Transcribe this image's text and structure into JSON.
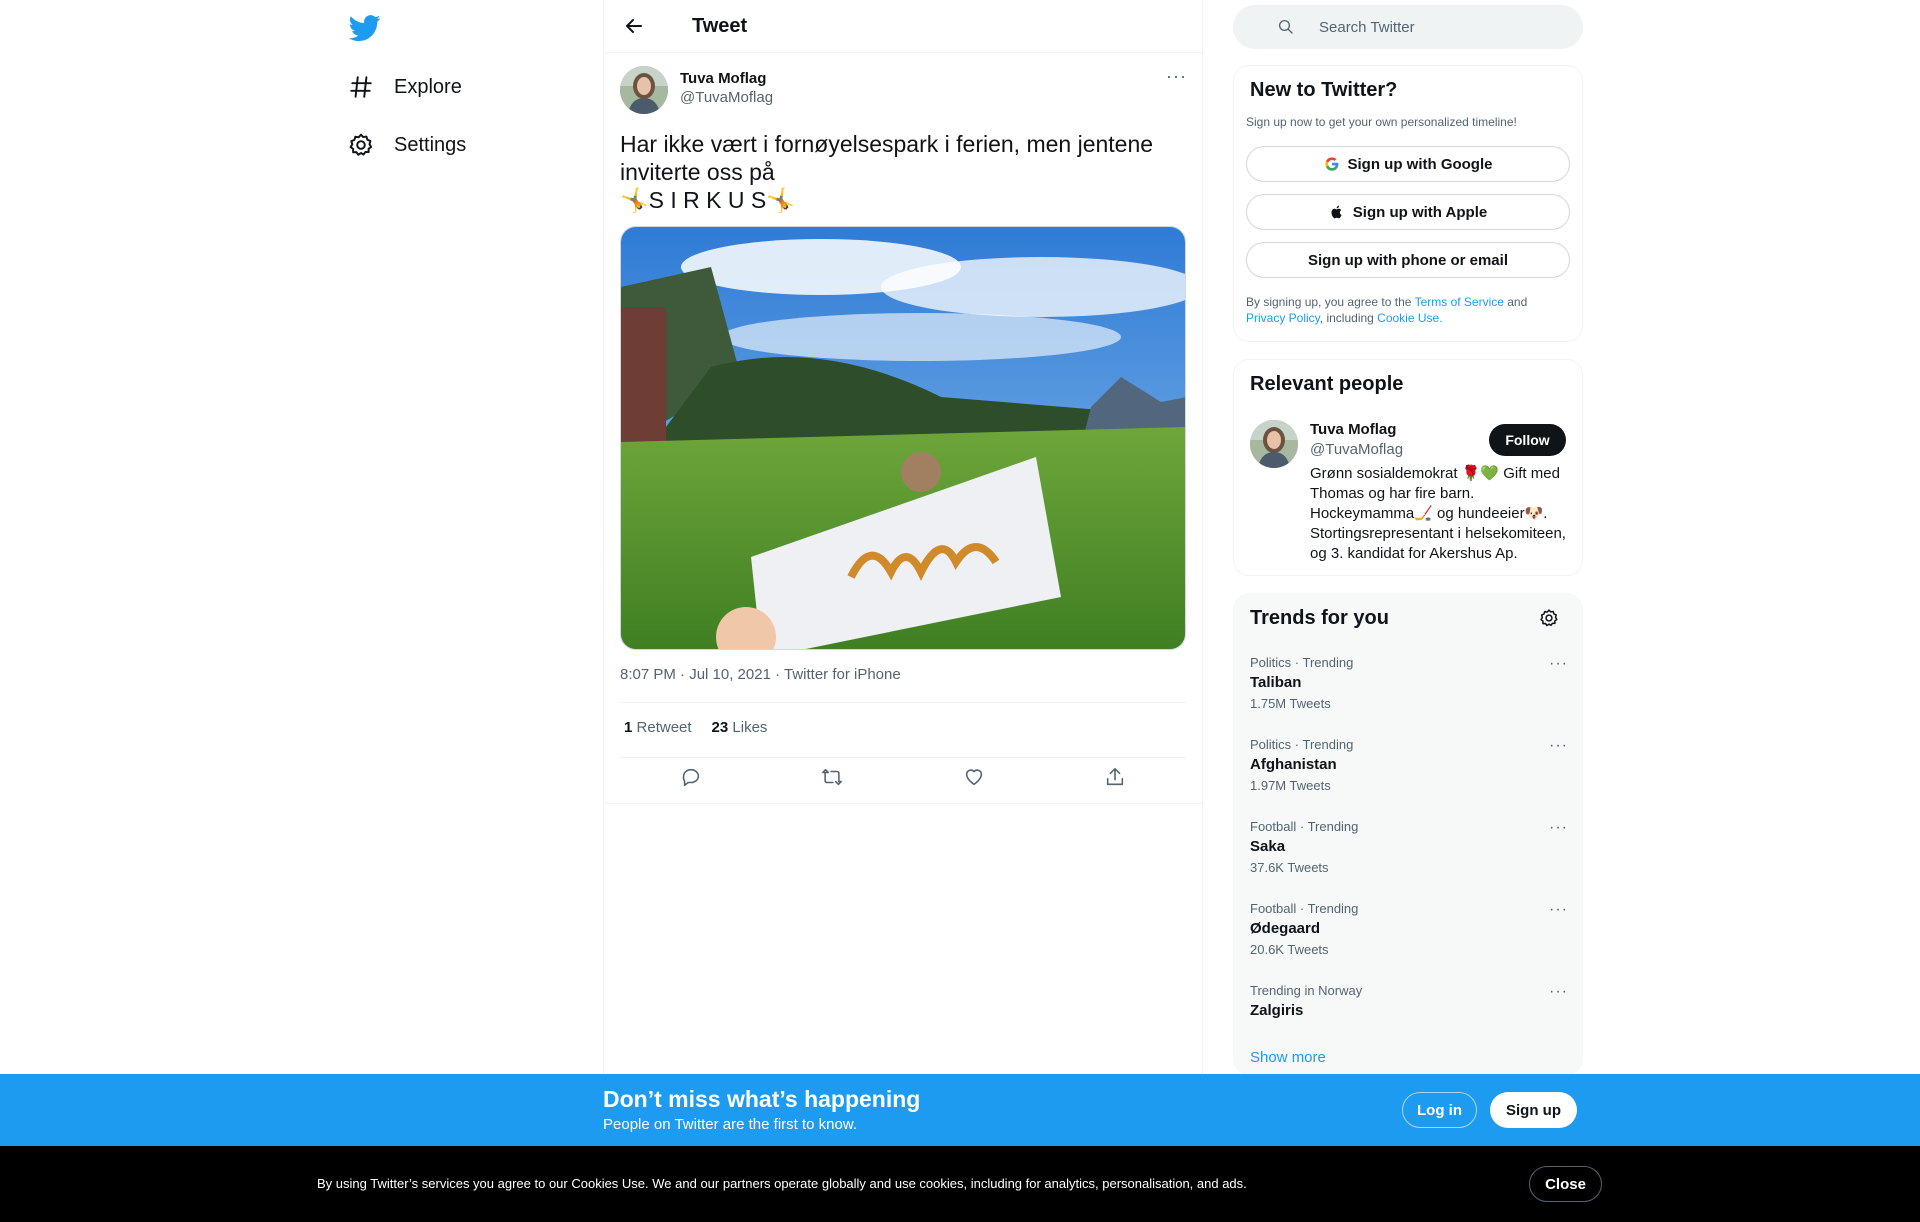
{
  "nav": {
    "logo_icon": "twitter-bird-icon",
    "items": [
      {
        "label": "Explore",
        "icon": "hashtag-icon"
      },
      {
        "label": "Settings",
        "icon": "gear-icon"
      }
    ]
  },
  "header": {
    "title": "Tweet"
  },
  "tweet": {
    "author_name": "Tuva Moflag",
    "author_handle": "@TuvaMoflag",
    "text": "Har ikke vært i fornøyelsespark i ferien, men jentene inviterte oss på\n🤸S I R K U S🤸",
    "image_alt_text": "SIRKUS",
    "timestamp": "8:07 PM · Jul 10, 2021 · Twitter for iPhone",
    "retweets_count": "1",
    "retweets_label": "Retweet",
    "likes_count": "23",
    "likes_label": "Likes"
  },
  "search": {
    "placeholder": "Search Twitter"
  },
  "signup_card": {
    "title": "New to Twitter?",
    "subtitle": "Sign up now to get your own personalized timeline!",
    "google_label": "Sign up with Google",
    "apple_label": "Sign up with Apple",
    "phone_label": "Sign up with phone or email",
    "legal_prefix": "By signing up, you agree to the ",
    "terms_link": "Terms of Service",
    "legal_and": " and ",
    "privacy_link": "Privacy Policy",
    "legal_including": ", including ",
    "cookie_link": "Cookie Use."
  },
  "relevant_people": {
    "title": "Relevant people",
    "name": "Tuva Moflag",
    "handle": "@TuvaMoflag",
    "follow_label": "Follow",
    "bio": "Grønn sosialdemokrat 🌹💚 Gift med Thomas og har fire barn. Hockeymamma🏒 og hundeeier🐶. Stortingsrepresentant i helsekomiteen, og 3. kandidat for Akershus Ap."
  },
  "trends": {
    "title": "Trends for you",
    "items": [
      {
        "category": "Politics · Trending",
        "name": "Taliban",
        "count": "1.75M Tweets"
      },
      {
        "category": "Politics · Trending",
        "name": "Afghanistan",
        "count": "1.97M Tweets"
      },
      {
        "category": "Football · Trending",
        "name": "Saka",
        "count": "37.6K Tweets"
      },
      {
        "category": "Football · Trending",
        "name": "Ødegaard",
        "count": "20.6K Tweets"
      },
      {
        "category": "Trending in Norway",
        "name": "Zalgiris",
        "count": ""
      }
    ],
    "show_more": "Show more"
  },
  "bottom_bar": {
    "title": "Don’t miss what’s happening",
    "subtitle": "People on Twitter are the first to know.",
    "login_label": "Log in",
    "signup_label": "Sign up"
  },
  "cookie_bar": {
    "text": "By using Twitter’s services you agree to our Cookies Use. We and our partners operate globally and use cookies, including for analytics, personalisation, and ads.",
    "close_label": "Close"
  },
  "colors": {
    "accent": "#1d9bf0",
    "text": "#0f1419",
    "secondary": "#536471"
  }
}
